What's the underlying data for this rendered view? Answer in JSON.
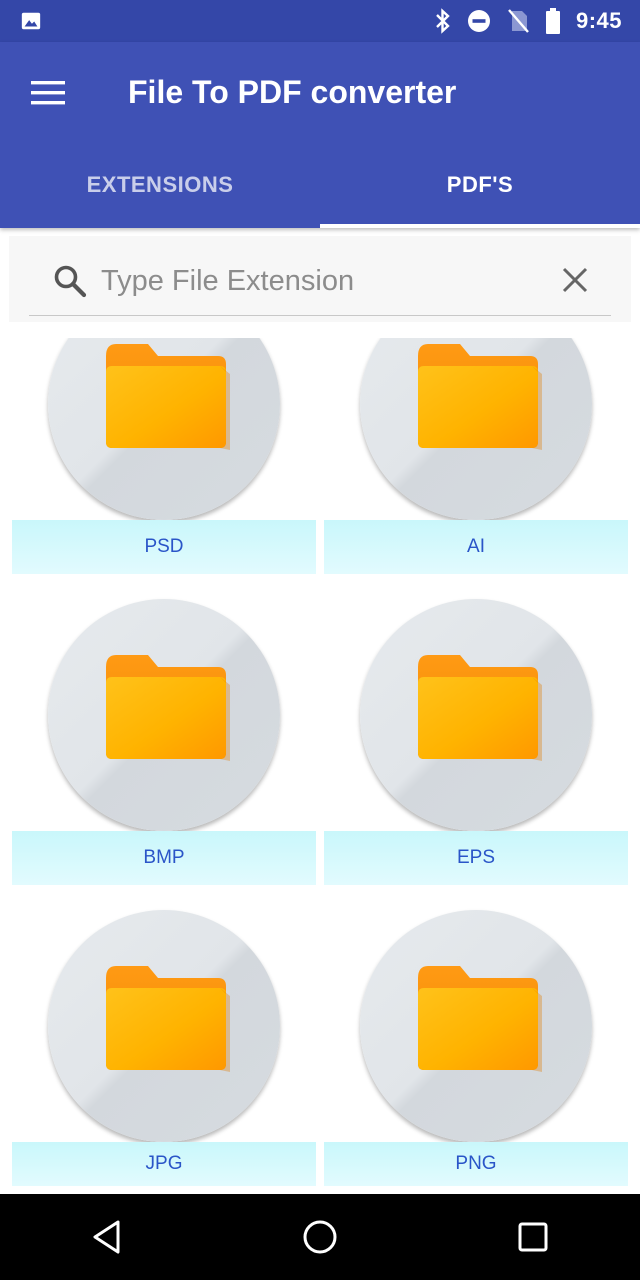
{
  "status_bar": {
    "time": "9:45",
    "icons": [
      "image-icon",
      "bluetooth-icon",
      "do-not-disturb-icon",
      "no-sim-icon",
      "battery-icon"
    ]
  },
  "app_bar": {
    "title": "File To PDF converter",
    "menu_icon": "hamburger-menu-icon"
  },
  "tabs": [
    {
      "label": "EXTENSIONS",
      "selected": false
    },
    {
      "label": "PDF'S",
      "selected": true
    }
  ],
  "search": {
    "placeholder": "Type File Extension",
    "value": "",
    "search_icon": "search-icon",
    "clear_icon": "close-icon"
  },
  "extensions": [
    {
      "label": "PSD",
      "icon": "folder-icon"
    },
    {
      "label": "AI",
      "icon": "folder-icon"
    },
    {
      "label": "BMP",
      "icon": "folder-icon"
    },
    {
      "label": "EPS",
      "icon": "folder-icon"
    },
    {
      "label": "JPG",
      "icon": "folder-icon"
    },
    {
      "label": "PNG",
      "icon": "folder-icon"
    }
  ],
  "nav_bar": {
    "buttons": [
      "back-icon",
      "home-icon",
      "recents-icon"
    ]
  },
  "colors": {
    "primary": "#3f51b5",
    "primary_dark": "#3447a8",
    "label_background": "#ccf8fc",
    "label_text": "#2a55c8",
    "folder": "#ffb300"
  }
}
